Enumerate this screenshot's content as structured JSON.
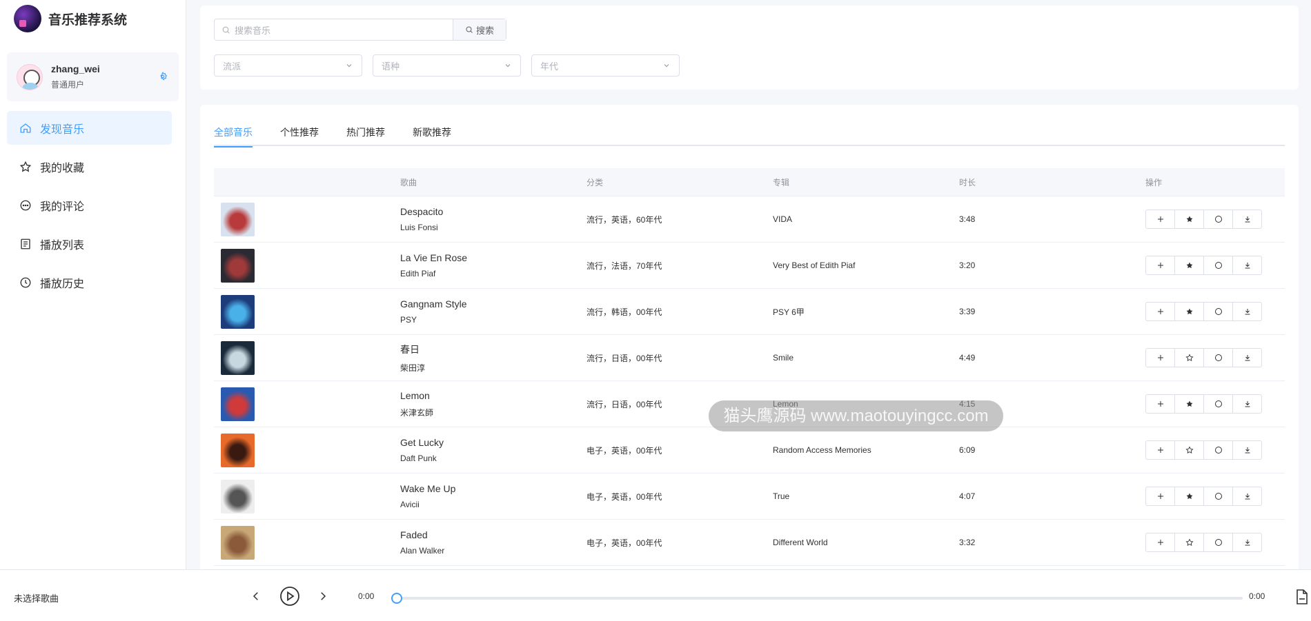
{
  "app": {
    "title": "音乐推荐系统"
  },
  "user": {
    "name": "zhang_wei",
    "role": "普通用户"
  },
  "nav": [
    {
      "label": "发现音乐",
      "icon": "home-icon",
      "active": true
    },
    {
      "label": "我的收藏",
      "icon": "star-icon",
      "active": false
    },
    {
      "label": "我的评论",
      "icon": "comment-icon",
      "active": false
    },
    {
      "label": "播放列表",
      "icon": "playlist-icon",
      "active": false
    },
    {
      "label": "播放历史",
      "icon": "history-icon",
      "active": false
    }
  ],
  "search": {
    "placeholder": "搜索音乐",
    "button": "搜索"
  },
  "filters": {
    "genre": "流派",
    "language": "语种",
    "era": "年代"
  },
  "tabs": [
    {
      "label": "全部音乐",
      "active": true
    },
    {
      "label": "个性推荐",
      "active": false
    },
    {
      "label": "热门推荐",
      "active": false
    },
    {
      "label": "新歌推荐",
      "active": false
    }
  ],
  "table": {
    "headers": {
      "cover": "",
      "song": "歌曲",
      "category": "分类",
      "album": "专辑",
      "duration": "时长",
      "actions": "操作"
    },
    "rows": [
      {
        "title": "Despacito",
        "artist": "Luis Fonsi",
        "category": "流行，英语，60年代",
        "album": "VIDA",
        "duration": "3:48",
        "favorited": true,
        "cover_colors": [
          "#d8e2ee",
          "#b93a3a"
        ]
      },
      {
        "title": "La Vie En Rose",
        "artist": "Edith Piaf",
        "category": "流行，法语，70年代",
        "album": "Very Best of Edith Piaf",
        "duration": "3:20",
        "favorited": true,
        "cover_colors": [
          "#2a2a33",
          "#a03a3a"
        ]
      },
      {
        "title": "Gangnam Style",
        "artist": "PSY",
        "category": "流行，韩语，00年代",
        "album": "PSY 6甲",
        "duration": "3:39",
        "favorited": true,
        "cover_colors": [
          "#1c3c7a",
          "#4ab0e8"
        ]
      },
      {
        "title": "春日",
        "artist": "柴田淳",
        "category": "流行，日语，00年代",
        "album": "Smile",
        "duration": "4:49",
        "favorited": false,
        "cover_colors": [
          "#1b2a3a",
          "#c8d8e0"
        ]
      },
      {
        "title": "Lemon",
        "artist": "米津玄師",
        "category": "流行，日语，00年代",
        "album": "Lemon",
        "duration": "4:15",
        "favorited": true,
        "cover_colors": [
          "#2a5ab0",
          "#d03a3a"
        ]
      },
      {
        "title": "Get Lucky",
        "artist": "Daft Punk",
        "category": "电子，英语，00年代",
        "album": "Random Access Memories",
        "duration": "6:09",
        "favorited": false,
        "cover_colors": [
          "#e86a2a",
          "#3a1a10"
        ]
      },
      {
        "title": "Wake Me Up",
        "artist": "Avicii",
        "category": "电子，英语，00年代",
        "album": "True",
        "duration": "4:07",
        "favorited": true,
        "cover_colors": [
          "#eeeeee",
          "#555555"
        ]
      },
      {
        "title": "Faded",
        "artist": "Alan Walker",
        "category": "电子，英语，00年代",
        "album": "Different World",
        "duration": "3:32",
        "favorited": false,
        "cover_colors": [
          "#c9a878",
          "#8a5a3a"
        ]
      }
    ]
  },
  "watermark": "猫头鹰源码 www.maotouyingcc.com",
  "player": {
    "now_playing": "未选择歌曲",
    "current_time": "0:00",
    "total_time": "0:00",
    "progress": 0
  },
  "colors": {
    "accent": "#409eff",
    "border": "#dcdfe6",
    "background": "#f5f7fa"
  }
}
